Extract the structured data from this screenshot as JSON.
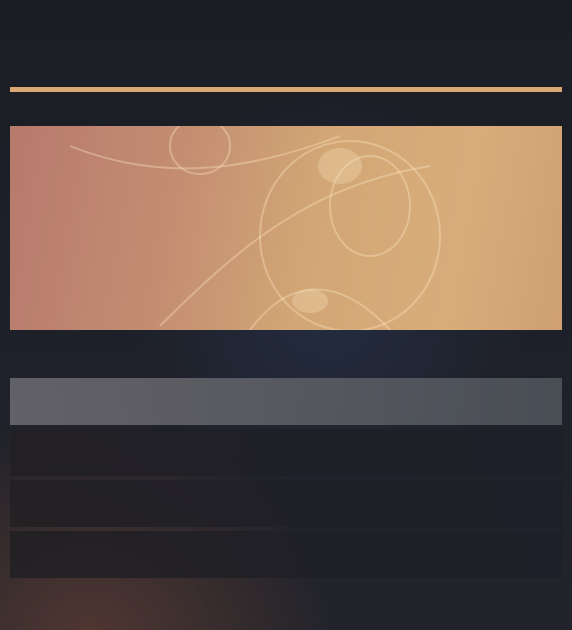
{
  "colors": {
    "accent": "#d9a874",
    "background": "#1c1e26",
    "banner_start": "#b67a6c",
    "banner_end": "#d8ad7a",
    "selected_row": "#66666c",
    "row": "#222228"
  },
  "banner": {
    "icon": "banner-artwork"
  },
  "list": {
    "items": [
      {
        "label": "",
        "state": "selected"
      },
      {
        "label": "",
        "state": "normal"
      },
      {
        "label": "",
        "state": "normal"
      },
      {
        "label": "",
        "state": "normal"
      }
    ]
  }
}
